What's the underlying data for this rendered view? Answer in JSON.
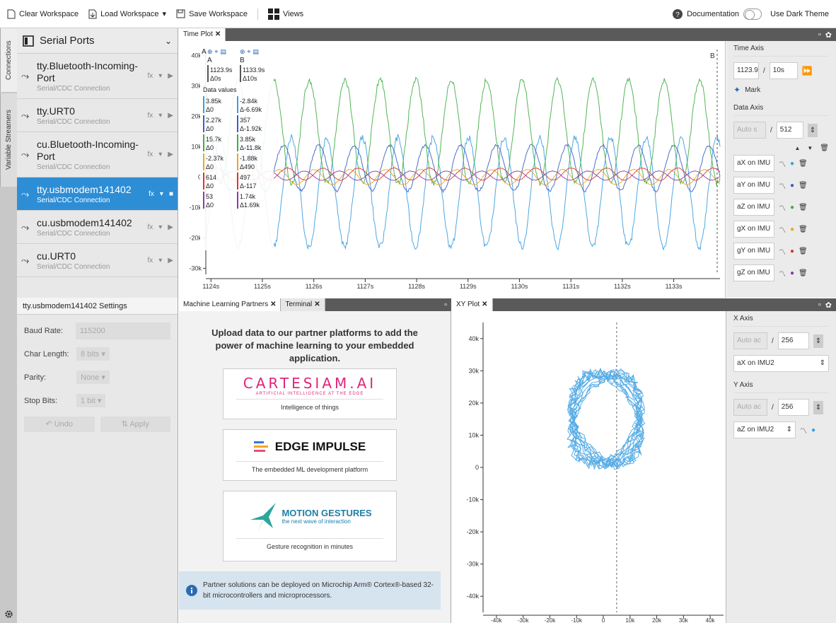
{
  "toolbar": {
    "clear": "Clear Workspace",
    "load": "Load Workspace",
    "save": "Save Workspace",
    "views": "Views",
    "documentation": "Documentation",
    "dark_theme": "Use Dark Theme"
  },
  "side_tabs": [
    "Connections",
    "Variable Streamers"
  ],
  "serial_ports": {
    "title": "Serial Ports",
    "items": [
      {
        "name": "tty.Bluetooth-Incoming-Port",
        "type": "Serial/CDC Connection"
      },
      {
        "name": "tty.URT0",
        "type": "Serial/CDC Connection"
      },
      {
        "name": "cu.Bluetooth-Incoming-Port",
        "type": "Serial/CDC Connection"
      },
      {
        "name": "tty.usbmodem141402",
        "type": "Serial/CDC Connection",
        "selected": true
      },
      {
        "name": "cu.usbmodem141402",
        "type": "Serial/CDC Connection"
      },
      {
        "name": "cu.URT0",
        "type": "Serial/CDC Connection"
      }
    ]
  },
  "settings": {
    "title": "tty.usbmodem141402 Settings",
    "baud_label": "Baud Rate:",
    "baud_value": "115200",
    "char_label": "Char Length:",
    "char_value": "8 bits",
    "parity_label": "Parity:",
    "parity_value": "None",
    "stop_label": "Stop Bits:",
    "stop_value": "1 bit",
    "undo": "Undo",
    "apply": "Apply"
  },
  "time_plot": {
    "tab": "Time Plot",
    "cursor_a": "A",
    "cursor_b": "B",
    "time_a": "1123.9s",
    "delta_a": "Δ0s",
    "time_b": "1133.9s",
    "delta_b": "Δ10s",
    "data_values_label": "Data values",
    "values": [
      {
        "a": "3.85k",
        "da": "Δ0",
        "b": "-2.84k",
        "db": "Δ-6.69k",
        "color": "#3a9ee0"
      },
      {
        "a": "2.27k",
        "da": "Δ0",
        "b": "357",
        "db": "Δ-1.92k",
        "color": "#3b5fc4"
      },
      {
        "a": "15.7k",
        "da": "Δ0",
        "b": "3.85k",
        "db": "Δ-11.8k",
        "color": "#3fae45"
      },
      {
        "a": "-2.37k",
        "da": "Δ0",
        "b": "-1.88k",
        "db": "Δ490",
        "color": "#e8a820"
      },
      {
        "a": "614",
        "da": "Δ0",
        "b": "497",
        "db": "Δ-117",
        "color": "#d9382e"
      },
      {
        "a": "53",
        "da": "Δ0",
        "b": "1.74k",
        "db": "Δ1.69k",
        "color": "#8a3aa8"
      }
    ]
  },
  "time_axis": {
    "title": "Time Axis",
    "start": "1123.9",
    "span": "10s",
    "mark": "Mark"
  },
  "data_axis": {
    "title": "Data Axis",
    "auto": "Auto s",
    "value": "512",
    "series": [
      {
        "name": "aX on IMU",
        "color": "#3a9ee0"
      },
      {
        "name": "aY on IMU",
        "color": "#3b5fc4"
      },
      {
        "name": "aZ on IMU",
        "color": "#3fae45"
      },
      {
        "name": "gX on IMU",
        "color": "#e8a820"
      },
      {
        "name": "gY on IMU",
        "color": "#d9382e"
      },
      {
        "name": "gZ on IMU",
        "color": "#8a3aa8"
      }
    ]
  },
  "ml_partners": {
    "tab": "Machine Learning Partners",
    "terminal_tab": "Terminal",
    "intro": "Upload data to our partner platforms to add the power of machine learning to your embedded application.",
    "partners": [
      {
        "logo": "CARTESIAM.AI",
        "sub": "ARTIFICIAL INTELLIGENCE AT THE EDGE",
        "caption": "Intelligence of things"
      },
      {
        "logo": "EDGE IMPULSE",
        "sub": "",
        "caption": "The embedded ML development platform"
      },
      {
        "logo": "MOTION GESTURES",
        "sub": "the next wave of interaction",
        "caption": "Gesture recognition in minutes"
      }
    ],
    "info": "Partner solutions can be deployed on Microchip Arm® Cortex®-based 32-bit microcontrollers and microprocessors."
  },
  "xy_plot": {
    "tab": "XY Plot",
    "x_axis_title": "X Axis",
    "x_auto": "Auto ac",
    "x_value": "256",
    "x_series": "aX on IMU2",
    "y_axis_title": "Y Axis",
    "y_auto": "Auto ac",
    "y_value": "256",
    "y_series": "aZ on IMU2"
  },
  "chart_data": [
    {
      "type": "line",
      "title": "Time Plot",
      "x_ticks": [
        "1124s",
        "1125s",
        "1126s",
        "1127s",
        "1128s",
        "1129s",
        "1130s",
        "1131s",
        "1132s",
        "1133s"
      ],
      "y_ticks": [
        "40k",
        "30k",
        "20k",
        "10k",
        "0",
        "-10k",
        "-20k",
        "-30k"
      ],
      "ylim": [
        -32000,
        42000
      ],
      "xlim": [
        1123.9,
        1133.9
      ],
      "grid": false,
      "series": [
        {
          "name": "aX on IMU",
          "color": "#3a9ee0",
          "mean": -5000,
          "amp": 18000,
          "period": 0.69,
          "phase": 0.0
        },
        {
          "name": "aY on IMU",
          "color": "#3b5fc4",
          "mean": 3000,
          "amp": 7500,
          "period": 0.69,
          "phase": 1.4
        },
        {
          "name": "aZ on IMU",
          "color": "#3fae45",
          "mean": 15000,
          "amp": 17000,
          "period": 0.69,
          "phase": 3.1
        },
        {
          "name": "gX on IMU",
          "color": "#e8a820",
          "mean": 0,
          "amp": 2500,
          "period": 0.69,
          "phase": 2.2
        },
        {
          "name": "gY on IMU",
          "color": "#d9382e",
          "mean": 1000,
          "amp": 2000,
          "period": 0.69,
          "phase": 0.7
        },
        {
          "name": "gZ on IMU",
          "color": "#8a3aa8",
          "mean": 500,
          "amp": 1500,
          "period": 0.69,
          "phase": 4.0
        }
      ]
    },
    {
      "type": "scatter",
      "title": "XY Plot",
      "x_ticks": [
        "-40k",
        "-30k",
        "-20k",
        "-10k",
        "0",
        "10k",
        "20k",
        "30k",
        "40k"
      ],
      "y_ticks": [
        "40k",
        "30k",
        "20k",
        "10k",
        "0",
        "-10k",
        "-20k",
        "-30k",
        "-40k"
      ],
      "xlim": [
        -45000,
        45000
      ],
      "ylim": [
        -45000,
        45000
      ],
      "loop": {
        "cx": 1000,
        "cy": 15000,
        "rx": 13000,
        "ry": 14000
      },
      "cursor_x": 5000
    }
  ]
}
